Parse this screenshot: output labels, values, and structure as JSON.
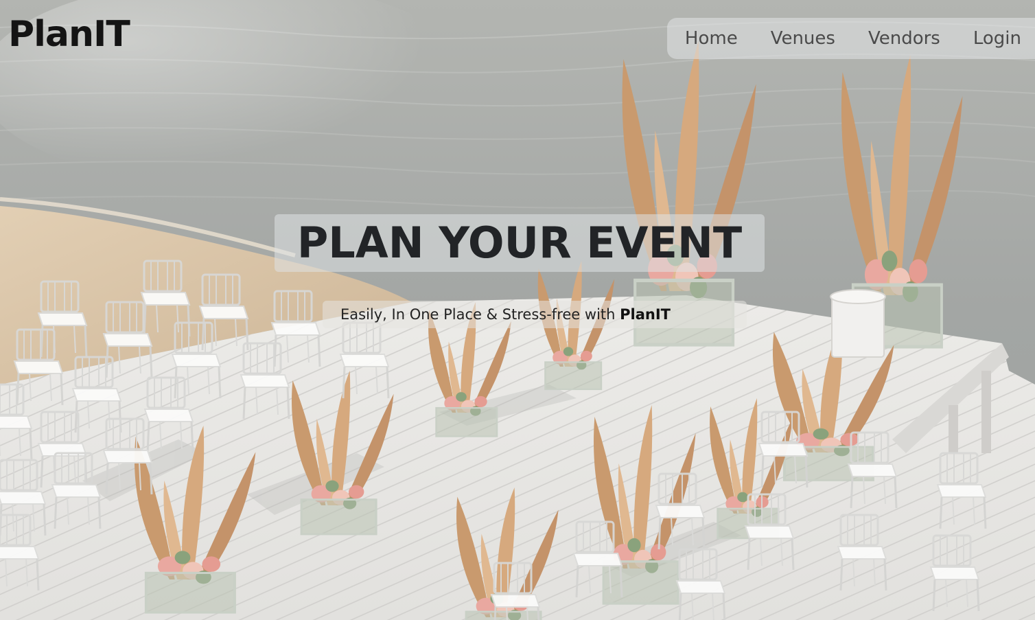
{
  "brand": {
    "name": "PlanIT"
  },
  "nav": {
    "items": [
      {
        "label": "Home"
      },
      {
        "label": "Venues"
      },
      {
        "label": "Vendors"
      },
      {
        "label": "Login"
      }
    ]
  },
  "hero": {
    "title": "PLAN YOUR EVENT",
    "subtitle_prefix": "Easily, In One Place & Stress-free with ",
    "subtitle_brand": "PlanIT"
  },
  "colors": {
    "text_dark": "#212529",
    "nav_text": "#4a4a4a",
    "water": "#a9aca9",
    "deck": "#e6e6e4",
    "sand": "#d9c4a6",
    "pampas": "#c89a6e"
  }
}
